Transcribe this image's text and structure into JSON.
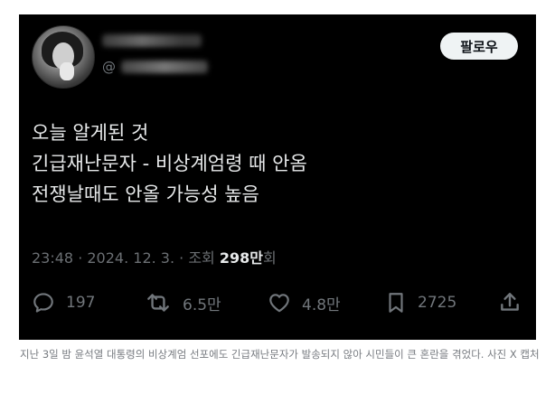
{
  "post": {
    "follow_label": "팔로우",
    "handle_prefix": "@",
    "text_lines": [
      "오늘 알게된 것",
      "긴급재난문자 - 비상계엄령 때 안옴",
      "전쟁날때도 안올 가능성 높음"
    ],
    "timestamp": "23:48 · 2024. 12. 3. · 조회 ",
    "views_number": "298만",
    "views_suffix": "회",
    "actions": {
      "reply_count": "197",
      "retweet_count": "6.5만",
      "like_count": "4.8만",
      "bookmark_count": "2725"
    },
    "icons": {
      "reply": "reply-icon",
      "retweet": "retweet-icon",
      "like": "heart-icon",
      "bookmark": "bookmark-icon",
      "share": "share-icon"
    },
    "colors": {
      "background": "#000000",
      "text": "#e7e9ea",
      "muted": "#71767b",
      "button_bg": "#eff3f4"
    }
  },
  "caption": "지난 3일 밤 윤석열 대통령의 비상계엄 선포에도 긴급재난문자가 발송되지 않아 시민들이 큰 혼란을 겪었다. 사진 X 캡처"
}
